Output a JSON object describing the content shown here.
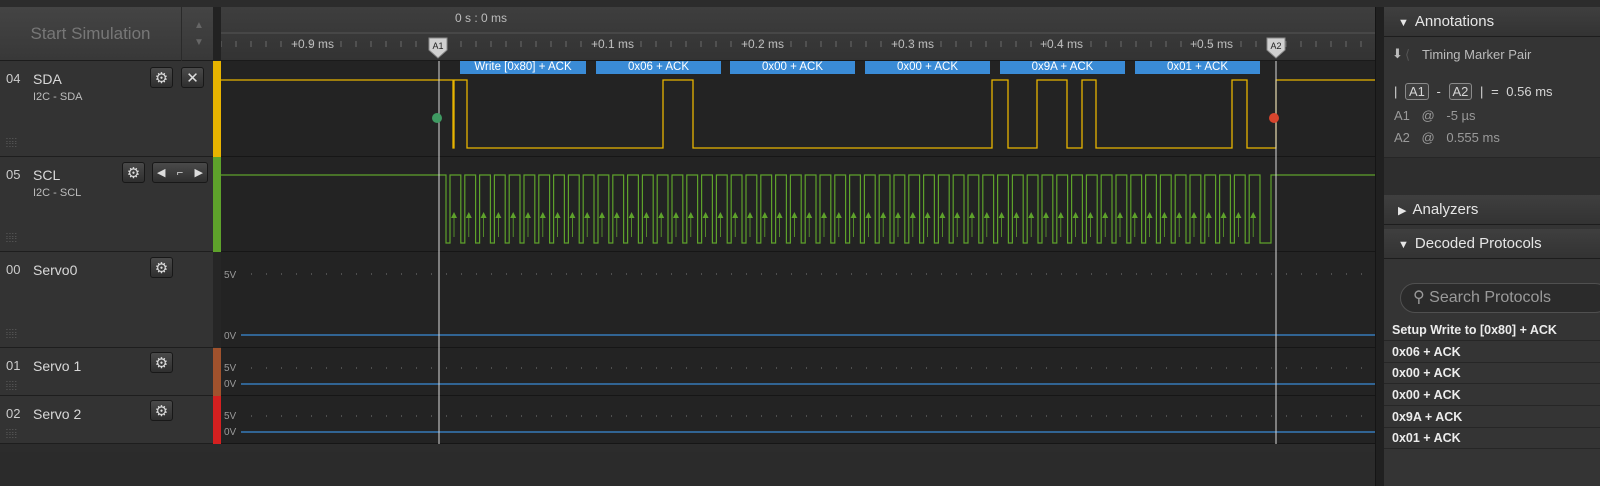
{
  "toolbar": {
    "start_simulation": "Start Simulation",
    "arrow_up": "▲",
    "arrow_down": "▼"
  },
  "timeline": {
    "origin_label": "0 s : 0 ms",
    "ticks": [
      "+0.9 ms",
      "+0.1 ms",
      "+0.2 ms",
      "+0.3 ms",
      "+0.4 ms",
      "+0.5 ms"
    ],
    "marker_a1": "A1",
    "marker_a2": "A2"
  },
  "channels": [
    {
      "num": "04",
      "name": "SDA",
      "sub": "I2C - SDA",
      "color": "#e8b400"
    },
    {
      "num": "05",
      "name": "SCL",
      "sub": "I2C - SCL",
      "color": "#5ea22b"
    },
    {
      "num": "00",
      "name": "Servo0",
      "sub": "",
      "color": "#2f2f2f"
    },
    {
      "num": "01",
      "name": "Servo 1",
      "sub": "",
      "color": "#a0522d"
    },
    {
      "num": "02",
      "name": "Servo 2",
      "sub": "",
      "color": "#d42020"
    }
  ],
  "analog_labels": {
    "v5": "5V",
    "v0": "0V"
  },
  "decoded_bubbles": [
    "Write [0x80] + ACK",
    "0x06 + ACK",
    "0x00 + ACK",
    "0x00 + ACK",
    "0x9A + ACK",
    "0x01 + ACK"
  ],
  "annotations": {
    "title": "Annotations",
    "marker_pair": "Timing Marker Pair",
    "a1": "A1",
    "a2": "A2",
    "minus": "-",
    "equals": "=",
    "delta": "0.56 ms",
    "a1_label": "A1",
    "a2_label": "A2",
    "at": "@",
    "a1_value": "-5 µs",
    "a2_value": "0.555 ms"
  },
  "analyzers": {
    "title": "Analyzers"
  },
  "decoded_protocols": {
    "title": "Decoded Protocols",
    "search_placeholder": "Search Protocols",
    "rows": [
      "Setup Write to [0x80] + ACK",
      "0x06 + ACK",
      "0x00 + ACK",
      "0x00 + ACK",
      "0x9A + ACK",
      "0x01 + ACK"
    ]
  },
  "colors": {
    "sda": "#e8b400",
    "scl": "#5ea22b",
    "analog": "#3a8bd6",
    "bubble": "#3a8bd6"
  }
}
